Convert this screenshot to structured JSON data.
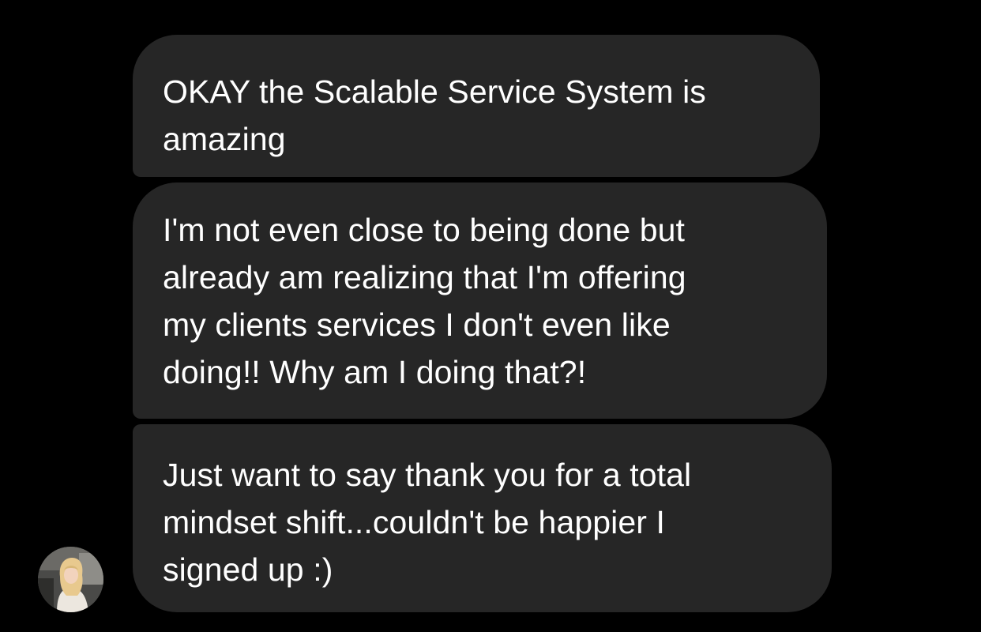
{
  "conversation": {
    "messages": [
      {
        "text": "OKAY the Scalable Service System is\namazing"
      },
      {
        "text": "I'm not even close to being done but\nalready am realizing that I'm offering\nmy clients services I don't even like\ndoing!! Why am I doing that?!"
      },
      {
        "text": "Just want to say thank you for a total\nmindset shift...couldn't be happier I\nsigned up :)"
      }
    ],
    "sender_avatar": "user-avatar-photo"
  },
  "colors": {
    "background": "#000000",
    "bubble": "#262626",
    "text": "#ffffff"
  }
}
